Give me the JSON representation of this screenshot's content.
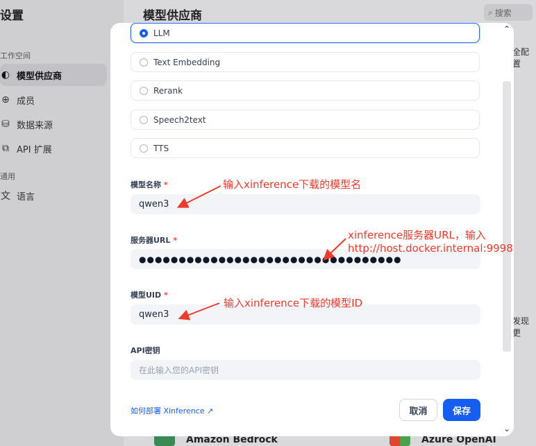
{
  "app": {
    "settings_title": "设置",
    "section_workspace": "工作空间",
    "section_general": "通用",
    "sidebar": [
      {
        "label": "模型供应商",
        "icon": "brain-icon",
        "active": true
      },
      {
        "label": "成员",
        "icon": "members-icon",
        "active": false
      },
      {
        "label": "数据来源",
        "icon": "database-icon",
        "active": false
      },
      {
        "label": "API 扩展",
        "icon": "api-extension-icon",
        "active": false
      }
    ],
    "language_item": {
      "label": "语言",
      "icon": "translate-icon"
    },
    "main_title": "模型供应商",
    "search_placeholder": "搜索",
    "right_partial_1": "全配置",
    "right_partial_2": "发现更",
    "cards": [
      "Amazon Bedrock",
      "Azure OpenAI"
    ]
  },
  "modal": {
    "model_types": [
      {
        "label": "LLM",
        "selected": true
      },
      {
        "label": "Text Embedding",
        "selected": false
      },
      {
        "label": "Rerank",
        "selected": false
      },
      {
        "label": "Speech2text",
        "selected": false
      },
      {
        "label": "TTS",
        "selected": false
      }
    ],
    "model_name": {
      "label": "模型名称",
      "required": "*",
      "value": "qwen3"
    },
    "server_url": {
      "label": "服务器URL",
      "required": "*",
      "value": "●●●●●●●●●●●●●●●●●●●●●●●●●●●●●●●●●"
    },
    "model_uid": {
      "label": "模型UID",
      "required": "*",
      "value": "qwen3"
    },
    "api_key": {
      "label": "API密钥",
      "placeholder": "在此输入您的API密钥"
    },
    "help_link": "如何部署 Xinference ↗",
    "cancel": "取消",
    "save": "保存"
  },
  "annotations": {
    "a1": "输入xinference下载的模型名",
    "a2_line1": "xinference服务器URL，输入",
    "a2_line2": "http://host.docker.internal:9998",
    "a3": "输入xinference下载的模型ID"
  },
  "colors": {
    "accent": "#155eef",
    "required": "#f04438",
    "annotation": "#ef3b2c"
  }
}
